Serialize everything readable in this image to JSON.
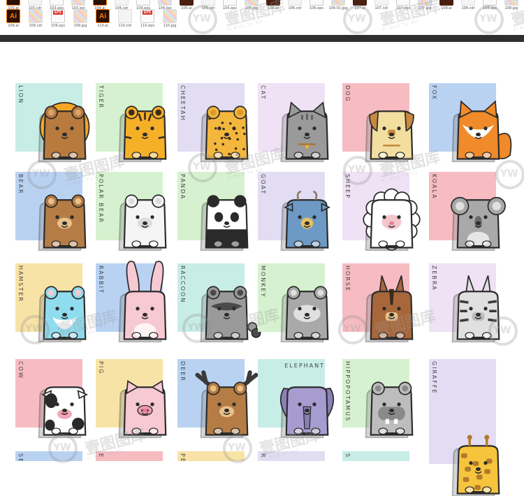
{
  "file_strip": {
    "row1": [
      {
        "label": "103.ai",
        "kind": "ai"
      },
      {
        "label": "103.cdr",
        "kind": "cdr"
      },
      {
        "label": "103.eps",
        "kind": "eps"
      },
      {
        "label": "103.jpg",
        "kind": "jpg"
      },
      {
        "label": "104.ai",
        "kind": "ai"
      },
      {
        "label": "104.cdr",
        "kind": "cdr"
      },
      {
        "label": "104.eps",
        "kind": "eps"
      },
      {
        "label": "104.jpg",
        "kind": "jpg"
      },
      {
        "label": "105.ai",
        "kind": "dark"
      },
      {
        "label": "105.cdr",
        "kind": "cdr"
      },
      {
        "label": "105.eps",
        "kind": "eps"
      },
      {
        "label": "105.jpg",
        "kind": "jpg"
      },
      {
        "label": "106.ai",
        "kind": "dark"
      },
      {
        "label": "106.cdr",
        "kind": "cdr"
      },
      {
        "label": "106.eps",
        "kind": "eps"
      },
      {
        "label": "106-01.jpg",
        "kind": "jpg"
      },
      {
        "label": "107.ai",
        "kind": "dark"
      },
      {
        "label": "107.cdr",
        "kind": "cdr"
      },
      {
        "label": "107.eps",
        "kind": "eps"
      },
      {
        "label": "107.jpg",
        "kind": "jpg"
      },
      {
        "label": "108.ai",
        "kind": "dark"
      },
      {
        "label": "108.cdr",
        "kind": "cdr"
      },
      {
        "label": "108.eps",
        "kind": "eps"
      },
      {
        "label": "108.jpg",
        "kind": "jpg"
      }
    ],
    "row2": [
      {
        "label": "109.ai",
        "kind": "ai",
        "glyph": "Ai"
      },
      {
        "label": "109.cdr",
        "kind": "jpg"
      },
      {
        "label": "109.eps",
        "kind": "eps",
        "tag": "EPS"
      },
      {
        "label": "109.jpg",
        "kind": "jpg"
      },
      {
        "label": "110.ai",
        "kind": "ai",
        "glyph": "Ai"
      },
      {
        "label": "110.cdr",
        "kind": "cdr"
      },
      {
        "label": "110.eps",
        "kind": "eps",
        "tag": "EPS"
      },
      {
        "label": "110.jpg",
        "kind": "jpg"
      }
    ]
  },
  "watermark": {
    "brand": "壹图图库",
    "sub": "YI NUO TU KU",
    "logo": "YW"
  },
  "animals": [
    {
      "name": "LION",
      "bg": "#c7ede6",
      "color": "#b97a3e",
      "accent": "#f6a623",
      "type": "lion"
    },
    {
      "name": "TIGER",
      "bg": "#d6f1cf",
      "color": "#f6b027",
      "accent": "#3a2a1a",
      "type": "tiger"
    },
    {
      "name": "CHEETAH",
      "bg": "#e2ddf3",
      "color": "#f4b73d",
      "accent": "#3a2a1a",
      "type": "cheetah"
    },
    {
      "name": "CAT",
      "bg": "#efe2f5",
      "color": "#9a9a9a",
      "accent": "#5a5a5a",
      "type": "cat"
    },
    {
      "name": "DOG",
      "bg": "#f6bcc2",
      "color": "#f2dfa0",
      "accent": "#c7893f",
      "type": "dog"
    },
    {
      "name": "FOX",
      "bg": "#b9d2f2",
      "color": "#f08a2a",
      "accent": "#ffffff",
      "type": "fox"
    },
    {
      "name": "BEAR",
      "bg": "#b9d2f2",
      "color": "#b57c45",
      "accent": "#e8c08a",
      "type": "bear"
    },
    {
      "name": "POLAR BEAR",
      "bg": "#d6f1cf",
      "color": "#f5f5f5",
      "accent": "#dcdcdc",
      "type": "polar"
    },
    {
      "name": "PANDA",
      "bg": "#d6f1cf",
      "color": "#ffffff",
      "accent": "#2a2a2a",
      "type": "panda"
    },
    {
      "name": "GOAT",
      "bg": "#e2ddf3",
      "color": "#6d9ac4",
      "accent": "#e6c060",
      "type": "goat"
    },
    {
      "name": "SHEEP",
      "bg": "#efe2f5",
      "color": "#ffffff",
      "accent": "#f4c6cc",
      "type": "sheep"
    },
    {
      "name": "KOALA",
      "bg": "#f6bcc2",
      "color": "#a9a9a9",
      "accent": "#6a6a6a",
      "type": "koala"
    },
    {
      "name": "HAMSTER",
      "bg": "#f8e3a6",
      "color": "#8fdcef",
      "accent": "#ffffff",
      "type": "hamster"
    },
    {
      "name": "RABBIT",
      "bg": "#b9d2f2",
      "color": "#f7c9d3",
      "accent": "#ffffff",
      "type": "rabbit"
    },
    {
      "name": "RACCOON",
      "bg": "#c7ede6",
      "color": "#9a9a9a",
      "accent": "#4a4a4a",
      "type": "raccoon"
    },
    {
      "name": "MONKEY",
      "bg": "#d6f1cf",
      "color": "#a9a9a9",
      "accent": "#e0e0e0",
      "type": "monkey"
    },
    {
      "name": "HORSE",
      "bg": "#f6bcc2",
      "color": "#a8673a",
      "accent": "#e8c08a",
      "type": "horse"
    },
    {
      "name": "ZEBRA",
      "bg": "#efe2f5",
      "color": "#e0e0e0",
      "accent": "#3a3a3a",
      "type": "zebra"
    },
    {
      "name": "COW",
      "bg": "#f6bcc2",
      "color": "#ffffff",
      "accent": "#2a2a2a",
      "type": "cow"
    },
    {
      "name": "PIG",
      "bg": "#f8e3a6",
      "color": "#f7c9d3",
      "accent": "#f29bb0",
      "type": "pig"
    },
    {
      "name": "DEER",
      "bg": "#b9d2f2",
      "color": "#b57c45",
      "accent": "#3a3a3a",
      "type": "deer"
    },
    {
      "name": "ELEPHANT",
      "bg": "#c7ede6",
      "color": "#a79ccf",
      "accent": "#8a80b8",
      "type": "elephant"
    },
    {
      "name": "HIPPOPOTAMUS",
      "bg": "#d6f1cf",
      "color": "#bdbdbd",
      "accent": "#8a8a8a",
      "type": "hippo"
    },
    {
      "name": "GIRAFFE",
      "bg": "#e2ddf3",
      "color": "#f6c53d",
      "accent": "#b37a2b",
      "type": "giraffe"
    }
  ],
  "bottom_row_labels": [
    "SE",
    "E",
    "PE",
    "R",
    "S"
  ]
}
